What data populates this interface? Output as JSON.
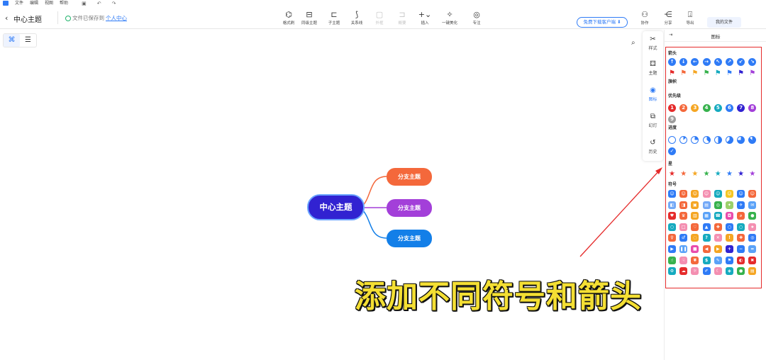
{
  "menubar": {
    "items": [
      "文件",
      "编辑",
      "视图",
      "帮助"
    ]
  },
  "header": {
    "back_icon": "‹",
    "title": "中心主题",
    "saved_prefix": "文件已保存到",
    "saved_link": "个人中心",
    "download_button": "免费下载客户端",
    "my_files": "我的文件",
    "right_tools": [
      {
        "label": "协作",
        "icon": "collaborate-icon"
      },
      {
        "label": "分享",
        "icon": "share-icon"
      },
      {
        "label": "导出",
        "icon": "export-icon"
      }
    ]
  },
  "toolbar": {
    "tools": [
      {
        "label": "格式刷",
        "icon": "format-brush-icon",
        "disabled": false
      },
      {
        "label": "同级主题",
        "icon": "sibling-topic-icon",
        "disabled": false
      },
      {
        "label": "子主题",
        "icon": "subtopic-icon",
        "disabled": false
      },
      {
        "label": "关系线",
        "icon": "relation-line-icon",
        "disabled": false
      },
      {
        "label": "外框",
        "icon": "boundary-icon",
        "disabled": true
      },
      {
        "label": "概要",
        "icon": "summary-icon",
        "disabled": true
      },
      {
        "label": "插入",
        "icon": "insert-icon",
        "disabled": false
      },
      {
        "label": "一键美化",
        "icon": "beautify-icon",
        "disabled": false
      },
      {
        "label": "专注",
        "icon": "focus-icon",
        "disabled": false
      }
    ]
  },
  "mindmap": {
    "central_topic": "中心主题",
    "branches": [
      {
        "label": "分支主题",
        "color": "#f4683b"
      },
      {
        "label": "分支主题",
        "color": "#a33fd9"
      },
      {
        "label": "分支主题",
        "color": "#137fe8"
      }
    ],
    "central_color": "#3122d1"
  },
  "caption": "添加不同符号和箭头",
  "sidenav": [
    {
      "label": "样式",
      "icon": "style-icon",
      "active": false
    },
    {
      "label": "主题",
      "icon": "theme-icon",
      "active": false
    },
    {
      "label": "图标",
      "icon": "icon-library-icon",
      "active": true
    },
    {
      "label": "幻灯",
      "icon": "slideshow-icon",
      "active": false
    },
    {
      "label": "历史",
      "icon": "history-icon",
      "active": false
    }
  ],
  "panel": {
    "title": "图标",
    "categories": [
      {
        "name": "箭头",
        "kind": "arrow",
        "icons": [
          {
            "glyph": "↑",
            "color": "#2f7bf6"
          },
          {
            "glyph": "↓",
            "color": "#2f7bf6"
          },
          {
            "glyph": "←",
            "color": "#2f7bf6"
          },
          {
            "glyph": "→",
            "color": "#2f7bf6"
          },
          {
            "glyph": "↖",
            "color": "#2f7bf6"
          },
          {
            "glyph": "↗",
            "color": "#2f7bf6"
          },
          {
            "glyph": "↙",
            "color": "#2f7bf6"
          },
          {
            "glyph": "↘",
            "color": "#2f7bf6"
          }
        ]
      },
      {
        "name": "旗帜",
        "kind": "flag",
        "icons": [
          {
            "glyph": "⚑",
            "color": "#e52b2b"
          },
          {
            "glyph": "⚑",
            "color": "#f4683b"
          },
          {
            "glyph": "⚑",
            "color": "#f5a623"
          },
          {
            "glyph": "⚑",
            "color": "#37b24d"
          },
          {
            "glyph": "⚑",
            "color": "#15aabf"
          },
          {
            "glyph": "⚑",
            "color": "#2f7bf6"
          },
          {
            "glyph": "⚑",
            "color": "#3122d1"
          },
          {
            "glyph": "⚑",
            "color": "#a33fd9"
          }
        ]
      },
      {
        "name": "优先级",
        "kind": "priority",
        "icons": [
          {
            "glyph": "1",
            "color": "#e52b2b"
          },
          {
            "glyph": "2",
            "color": "#f4683b"
          },
          {
            "glyph": "3",
            "color": "#f5a623"
          },
          {
            "glyph": "4",
            "color": "#37b24d"
          },
          {
            "glyph": "5",
            "color": "#15aabf"
          },
          {
            "glyph": "6",
            "color": "#2f7bf6"
          },
          {
            "glyph": "7",
            "color": "#3122d1"
          },
          {
            "glyph": "8",
            "color": "#a33fd9"
          },
          {
            "glyph": "9",
            "color": "#9e9e9e"
          }
        ]
      },
      {
        "name": "进度",
        "kind": "progress",
        "icons": [
          {
            "fraction": 0,
            "color": "#2f7bf6"
          },
          {
            "fraction": 0.125,
            "color": "#2f7bf6"
          },
          {
            "fraction": 0.25,
            "color": "#2f7bf6"
          },
          {
            "fraction": 0.375,
            "color": "#2f7bf6"
          },
          {
            "fraction": 0.5,
            "color": "#2f7bf6"
          },
          {
            "fraction": 0.625,
            "color": "#2f7bf6"
          },
          {
            "fraction": 0.75,
            "color": "#2f7bf6"
          },
          {
            "fraction": 0.875,
            "color": "#2f7bf6"
          },
          {
            "fraction": 1,
            "color": "#2f7bf6",
            "glyph": "✓"
          }
        ]
      },
      {
        "name": "星",
        "kind": "star",
        "icons": [
          {
            "glyph": "★",
            "color": "#e52b2b"
          },
          {
            "glyph": "★",
            "color": "#f4683b"
          },
          {
            "glyph": "★",
            "color": "#f5a623"
          },
          {
            "glyph": "★",
            "color": "#37b24d"
          },
          {
            "glyph": "★",
            "color": "#15aabf"
          },
          {
            "glyph": "★",
            "color": "#2f7bf6"
          },
          {
            "glyph": "★",
            "color": "#3122d1"
          },
          {
            "glyph": "★",
            "color": "#a33fd9"
          }
        ]
      },
      {
        "name": "符号",
        "kind": "symbol",
        "icons": [
          {
            "glyph": "☺",
            "color": "#2f7bf6"
          },
          {
            "glyph": "☺",
            "color": "#f4683b"
          },
          {
            "glyph": "☺",
            "color": "#f5a623"
          },
          {
            "glyph": "☺",
            "color": "#f48fb1"
          },
          {
            "glyph": "☺",
            "color": "#15aabf"
          },
          {
            "glyph": "☺",
            "color": "#f5c623"
          },
          {
            "glyph": "☺",
            "color": "#2f7bf6"
          },
          {
            "glyph": "☺",
            "color": "#f4683b"
          },
          {
            "glyph": "◧",
            "color": "#74a9f7"
          },
          {
            "glyph": "◨",
            "color": "#f4683b"
          },
          {
            "glyph": "▣",
            "color": "#f5a623"
          },
          {
            "glyph": "▤",
            "color": "#74a9f7"
          },
          {
            "glyph": "◎",
            "color": "#37b24d"
          },
          {
            "glyph": "✦",
            "color": "#9bd06a"
          },
          {
            "glyph": "✈",
            "color": "#2f7bf6"
          },
          {
            "glyph": "✉",
            "color": "#5aa2f8"
          },
          {
            "glyph": "♥",
            "color": "#e52b2b"
          },
          {
            "glyph": "♛",
            "color": "#f4683b"
          },
          {
            "glyph": "▥",
            "color": "#f5a623"
          },
          {
            "glyph": "▦",
            "color": "#5aa2f8"
          },
          {
            "glyph": "☎",
            "color": "#15aabf"
          },
          {
            "glyph": "◘",
            "color": "#e94cac"
          },
          {
            "glyph": "⌕",
            "color": "#f4683b"
          },
          {
            "glyph": "●",
            "color": "#37b24d"
          },
          {
            "glyph": "○",
            "color": "#15aabf"
          },
          {
            "glyph": "□",
            "color": "#f48fb1"
          },
          {
            "glyph": "♡",
            "color": "#f4683b"
          },
          {
            "glyph": "▲",
            "color": "#2f7bf6"
          },
          {
            "glyph": "✚",
            "color": "#f4683b"
          },
          {
            "glyph": "○",
            "color": "#2f7bf6"
          },
          {
            "glyph": "○",
            "color": "#15aabf"
          },
          {
            "glyph": "★",
            "color": "#f48fb1"
          },
          {
            "glyph": "♀",
            "color": "#f4683b"
          },
          {
            "glyph": "♂",
            "color": "#2f7bf6"
          },
          {
            "glyph": "◌",
            "color": "#f5a623"
          },
          {
            "glyph": "?",
            "color": "#15aabf"
          },
          {
            "glyph": "✕",
            "color": "#f48fb1"
          },
          {
            "glyph": "!",
            "color": "#f5a623"
          },
          {
            "glyph": "✚",
            "color": "#f4683b"
          },
          {
            "glyph": "◎",
            "color": "#2f7bf6"
          },
          {
            "glyph": "▶",
            "color": "#2f7bf6"
          },
          {
            "glyph": "❚❚",
            "color": "#5aa2f8"
          },
          {
            "glyph": "■",
            "color": "#e94cac"
          },
          {
            "glyph": "◀",
            "color": "#f4683b"
          },
          {
            "glyph": "▶",
            "color": "#f5a623"
          },
          {
            "glyph": "+",
            "color": "#3122d1"
          },
          {
            "glyph": "−",
            "color": "#2f7bf6"
          },
          {
            "glyph": "=",
            "color": "#5aa2f8"
          },
          {
            "glyph": "☝",
            "color": "#37b24d"
          },
          {
            "glyph": "☟",
            "color": "#f48fb1"
          },
          {
            "glyph": "¥",
            "color": "#f4683b"
          },
          {
            "glyph": "$",
            "color": "#15aabf"
          },
          {
            "glyph": "✎",
            "color": "#5aa2f8"
          },
          {
            "glyph": "⚑",
            "color": "#2f7bf6"
          },
          {
            "glyph": "◐",
            "color": "#e52b2b"
          },
          {
            "glyph": "✖",
            "color": "#e52b2b"
          },
          {
            "glyph": "⚙",
            "color": "#15aabf"
          },
          {
            "glyph": "☁",
            "color": "#e52b2b"
          },
          {
            "glyph": "☼",
            "color": "#f48fb1"
          },
          {
            "glyph": "✐",
            "color": "#2f7bf6"
          },
          {
            "glyph": "☾",
            "color": "#f48fb1"
          },
          {
            "glyph": "◈",
            "color": "#15aabf"
          },
          {
            "glyph": "●",
            "color": "#37b24d"
          },
          {
            "glyph": "▤",
            "color": "#f5a623"
          }
        ]
      }
    ]
  }
}
